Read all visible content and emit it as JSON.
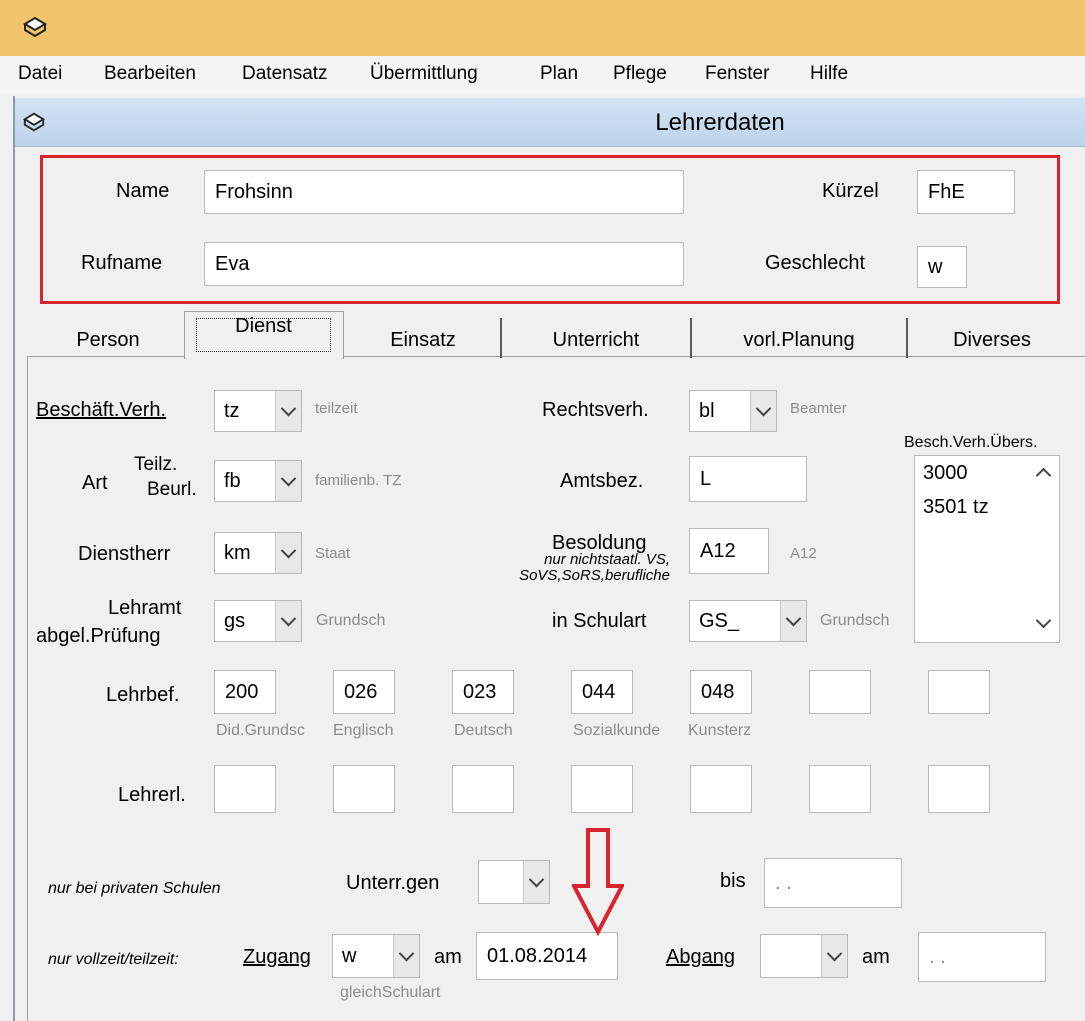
{
  "menu": [
    "Datei",
    "Bearbeiten",
    "Datensatz",
    "Übermittlung",
    "Plan",
    "Pflege",
    "Fenster",
    "Hilfe"
  ],
  "window": {
    "title": "Lehrerdaten"
  },
  "header": {
    "name_label": "Name",
    "name_value": "Frohsinn",
    "rufname_label": "Rufname",
    "rufname_value": "Eva",
    "kuerzel_label": "Kürzel",
    "kuerzel_value": "FhE",
    "geschlecht_label": "Geschlecht",
    "geschlecht_value": "w"
  },
  "tabs": [
    "Person",
    "Dienst",
    "Einsatz",
    "Unterricht",
    "vorl.Planung",
    "Diverses"
  ],
  "active_tab": "Dienst",
  "dienst": {
    "beschaeft_label": "Beschäft.Verh.",
    "beschaeft_value": "tz",
    "beschaeft_hint": "teilzeit",
    "art_label": "Art",
    "art_sub1": "Teilz.",
    "art_sub2": "Beurl.",
    "art_value": "fb",
    "art_hint": "familienb. TZ",
    "dienstherr_label": "Dienstherr",
    "dienstherr_value": "km",
    "dienstherr_hint": "Staat",
    "lehramt_label1": "Lehramt",
    "lehramt_label2": "abgel.Prüfung",
    "lehramt_value": "gs",
    "lehramt_hint": "Grundsch",
    "rechtsverh_label": "Rechtsverh.",
    "rechtsverh_value": "bl",
    "rechtsverh_hint": "Beamter",
    "amtsbez_label": "Amtsbez.",
    "amtsbez_value": "L",
    "besoldung_label": "Besoldung",
    "besoldung_note1": "nur nichtstaatl. VS,",
    "besoldung_note2": "SoVS,SoRS,berufliche",
    "besoldung_value": "A12",
    "besoldung_hint": "A12",
    "schulart_label": "in Schulart",
    "schulart_value": "GS_",
    "schulart_hint": "Grundsch",
    "besch_uebers_label": "Besch.Verh.Übers.",
    "besch_uebers_items": [
      "3000",
      "3501 tz"
    ],
    "lehrbef_label": "Lehrbef.",
    "lehrbef_values": [
      "200",
      "026",
      "023",
      "044",
      "048",
      "",
      ""
    ],
    "lehrbef_hints": [
      "Did.Grundsc",
      "Englisch",
      "Deutsch",
      "Sozialkunde",
      "Kunsterz",
      "",
      ""
    ],
    "lehrerl_label": "Lehrerl.",
    "privat_note": "nur bei privaten Schulen",
    "unterrgen_label": "Unterr.gen",
    "unterrgen_value": "",
    "bis_label": "bis",
    "bis_value": " .  .",
    "vollzeit_note": "nur vollzeit/teilzeit:",
    "zugang_label": "Zugang",
    "zugang_value": "w",
    "zugang_hint": "gleichSchulart",
    "am_label": "am",
    "zugang_date": "01.08.2014",
    "abgang_label": "Abgang",
    "abgang_value": "",
    "am2_label": "am",
    "abgang_date": " .  ."
  },
  "colors": {
    "annotation_red": "#d9232e",
    "titlebar": "#f1c36a",
    "window_title": "#c8dcf0"
  }
}
